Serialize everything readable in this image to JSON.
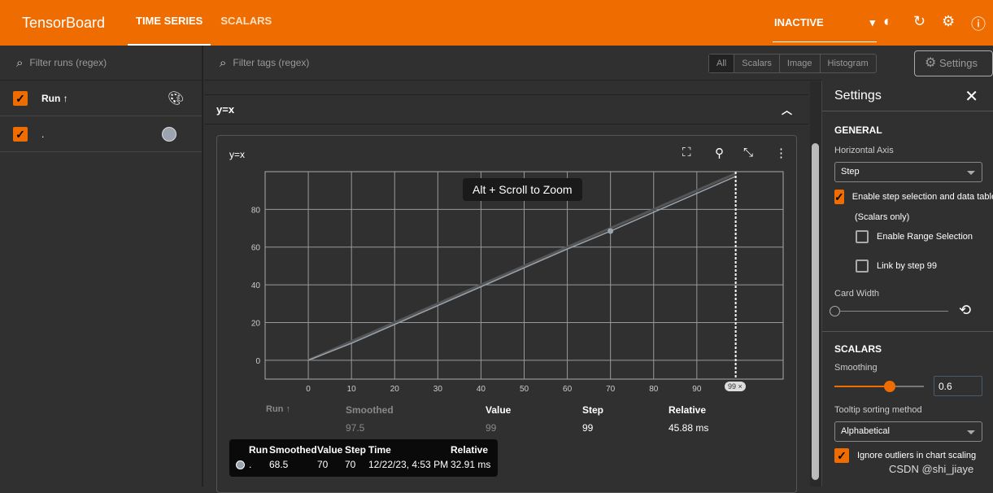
{
  "header": {
    "logo": "TensorBoard",
    "tabs": [
      "TIME SERIES",
      "SCALARS"
    ],
    "status": "INACTIVE",
    "icons": [
      "theme-icon",
      "refresh-icon",
      "settings-icon",
      "help-icon"
    ]
  },
  "left": {
    "filter_placeholder": "Filter runs (regex)",
    "run_header": "Run ↑",
    "runs": [
      {
        "name": ".",
        "color": "#9aa4ae"
      }
    ]
  },
  "main": {
    "filter_placeholder": "Filter tags (regex)",
    "type_filters": [
      "All",
      "Scalars",
      "Image",
      "Histogram"
    ],
    "settings_button": "Settings",
    "group_title": "y=x",
    "card": {
      "title": "y=x",
      "zoom_hint": "Alt + Scroll to Zoom",
      "step_marker": "99 ×",
      "table": {
        "headers": [
          "Run ↑",
          "Smoothed",
          "Value",
          "Step",
          "Relative"
        ],
        "row": {
          "smoothed": "97.5",
          "value": "99",
          "step": "99",
          "relative": "45.88 ms"
        }
      },
      "tooltip": {
        "headers": [
          "Run",
          "Smoothed",
          "Value",
          "Step",
          "Time",
          "Relative"
        ],
        "row": [
          ".",
          "68.5",
          "70",
          "70",
          "12/22/23, 4:53 PM",
          "32.91 ms"
        ]
      }
    }
  },
  "settings": {
    "title": "Settings",
    "general": "GENERAL",
    "horizontal_axis_label": "Horizontal Axis",
    "horizontal_axis": "Step",
    "enable_step": "Enable step selection and data table",
    "scalars_only": "(Scalars only)",
    "range_selection": "Enable Range Selection",
    "link_step": "Link by step 99",
    "card_width": "Card Width",
    "scalars": "SCALARS",
    "smoothing_label": "Smoothing",
    "smoothing": "0.6",
    "smoothing_fraction": 0.6,
    "card_width_fraction": 0,
    "tooltip_sort_label": "Tooltip sorting method",
    "tooltip_sort": "Alphabetical",
    "ignore_outliers": "Ignore outliers in chart scaling",
    "enable_step_checked": true,
    "ignore_outliers_checked": true
  },
  "watermark": "CSDN @shi_jiaye",
  "colors": {
    "accent": "#ef6c00",
    "line": "#9aa4ae"
  },
  "chart_data": {
    "type": "line",
    "title": "y=x",
    "xlim": [
      -10,
      110
    ],
    "ylim": [
      -10,
      100
    ],
    "xticks": [
      0,
      10,
      20,
      30,
      40,
      50,
      60,
      70,
      80,
      90
    ],
    "yticks": [
      0,
      20,
      40,
      60,
      80
    ],
    "grid": true,
    "selected_step": 99,
    "hover_point": {
      "x": 70,
      "y": 68.5
    },
    "series": [
      {
        "x": [
          0,
          10,
          20,
          30,
          40,
          50,
          60,
          70,
          80,
          90,
          99
        ],
        "y": [
          0,
          9,
          19,
          29,
          39,
          49,
          59,
          68.5,
          78.5,
          88.5,
          97.5
        ]
      }
    ]
  }
}
